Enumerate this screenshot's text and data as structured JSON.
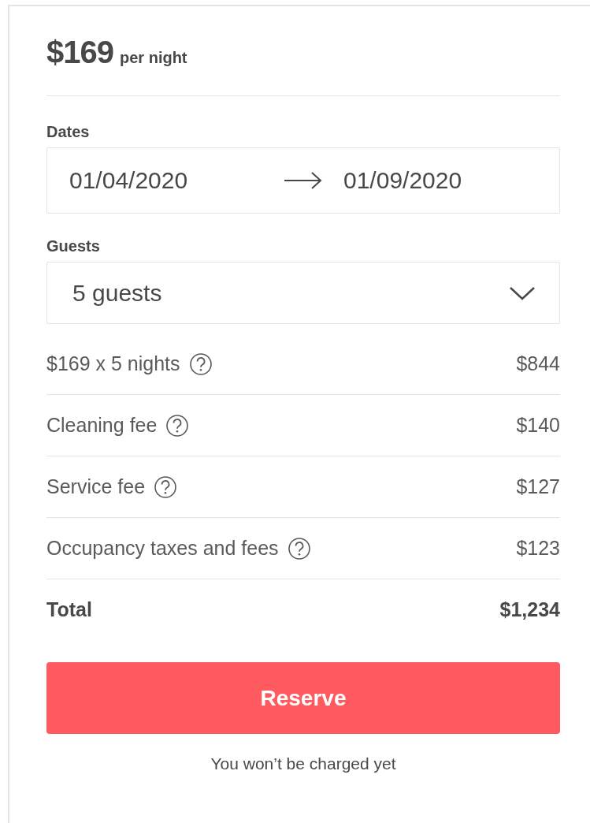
{
  "price": {
    "amount": "$169",
    "unit": "per night"
  },
  "dates": {
    "label": "Dates",
    "check_in": "01/04/2020",
    "check_out": "01/09/2020"
  },
  "guests": {
    "label": "Guests",
    "value": "5 guests"
  },
  "fees": [
    {
      "label": "$169 x 5 nights",
      "amount": "$844",
      "info": true
    },
    {
      "label": "Cleaning fee",
      "amount": "$140",
      "info": true
    },
    {
      "label": "Service fee",
      "amount": "$127",
      "info": true
    },
    {
      "label": "Occupancy taxes and fees",
      "amount": "$123",
      "info": true
    }
  ],
  "total": {
    "label": "Total",
    "amount": "$1,234"
  },
  "reserve_button": "Reserve",
  "note": "You won’t be charged yet"
}
